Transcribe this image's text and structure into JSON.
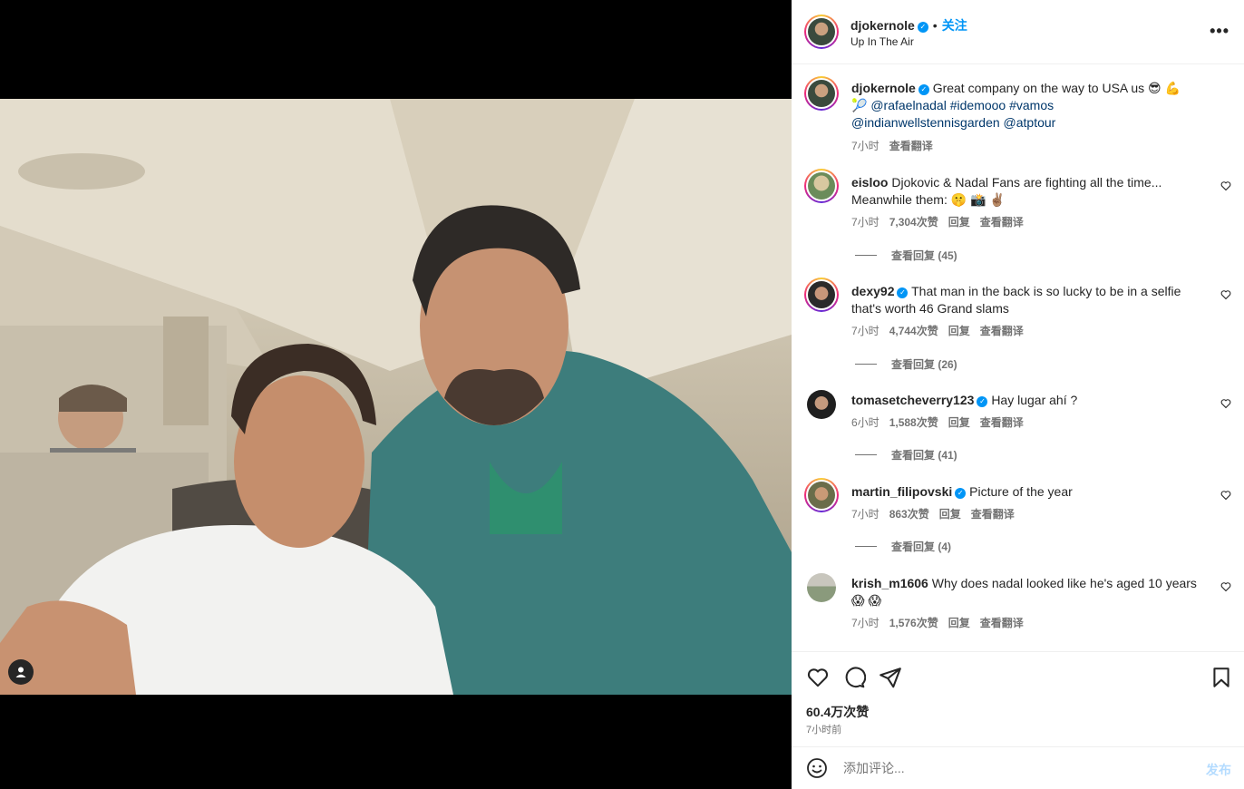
{
  "post": {
    "username": "djokernole",
    "follow_label": "关注",
    "location": "Up In The Air",
    "caption_text": "Great company on the way to USA us 😎 💪 🎾",
    "caption_links": [
      "@rafaelnadal",
      "#idemooo",
      "#vamos",
      "@indianwellstennisgarden",
      "@atptour"
    ],
    "caption_time": "7小时",
    "see_translation": "查看翻译"
  },
  "comments": [
    {
      "user": "eisloo",
      "verified": false,
      "text": "Djokovic & Nadal Fans are fighting all the time... Meanwhile them: 🤫 📸 ✌🏽",
      "time": "7小时",
      "likes": "7,304次赞",
      "reply": "回复",
      "translate": "查看翻译",
      "view_replies": "查看回复 (45)"
    },
    {
      "user": "dexy92",
      "verified": true,
      "text": "That man in the back is so lucky to be in a selfie that's worth 46 Grand slams",
      "time": "7小时",
      "likes": "4,744次赞",
      "reply": "回复",
      "translate": "查看翻译",
      "view_replies": "查看回复 (26)"
    },
    {
      "user": "tomasetcheverry123",
      "verified": true,
      "text": "Hay lugar ahí ?",
      "time": "6小时",
      "likes": "1,588次赞",
      "reply": "回复",
      "translate": "查看翻译",
      "view_replies": "查看回复 (41)"
    },
    {
      "user": "martin_filipovski",
      "verified": true,
      "text": "Picture of the year",
      "time": "7小时",
      "likes": "863次赞",
      "reply": "回复",
      "translate": "查看翻译",
      "view_replies": "查看回复 (4)"
    },
    {
      "user": "krish_m1606",
      "verified": false,
      "text": "Why does nadal looked like he's aged 10 years 😱 😱",
      "time": "7小时",
      "likes": "1,576次赞",
      "reply": "回复",
      "translate": "查看翻译"
    }
  ],
  "stats": {
    "likes": "60.4万次赞",
    "time_ago": "7小时前"
  },
  "compose": {
    "placeholder": "添加评论...",
    "post_label": "发布"
  },
  "icons": {
    "like": "heart-icon",
    "comment": "comment-icon",
    "share": "share-icon",
    "save": "bookmark-icon",
    "emoji": "emoji-icon",
    "more": "more-icon",
    "tag": "user-tag-icon"
  },
  "colors": {
    "accent": "#0095f6",
    "link": "#00376b",
    "muted": "#737373"
  }
}
